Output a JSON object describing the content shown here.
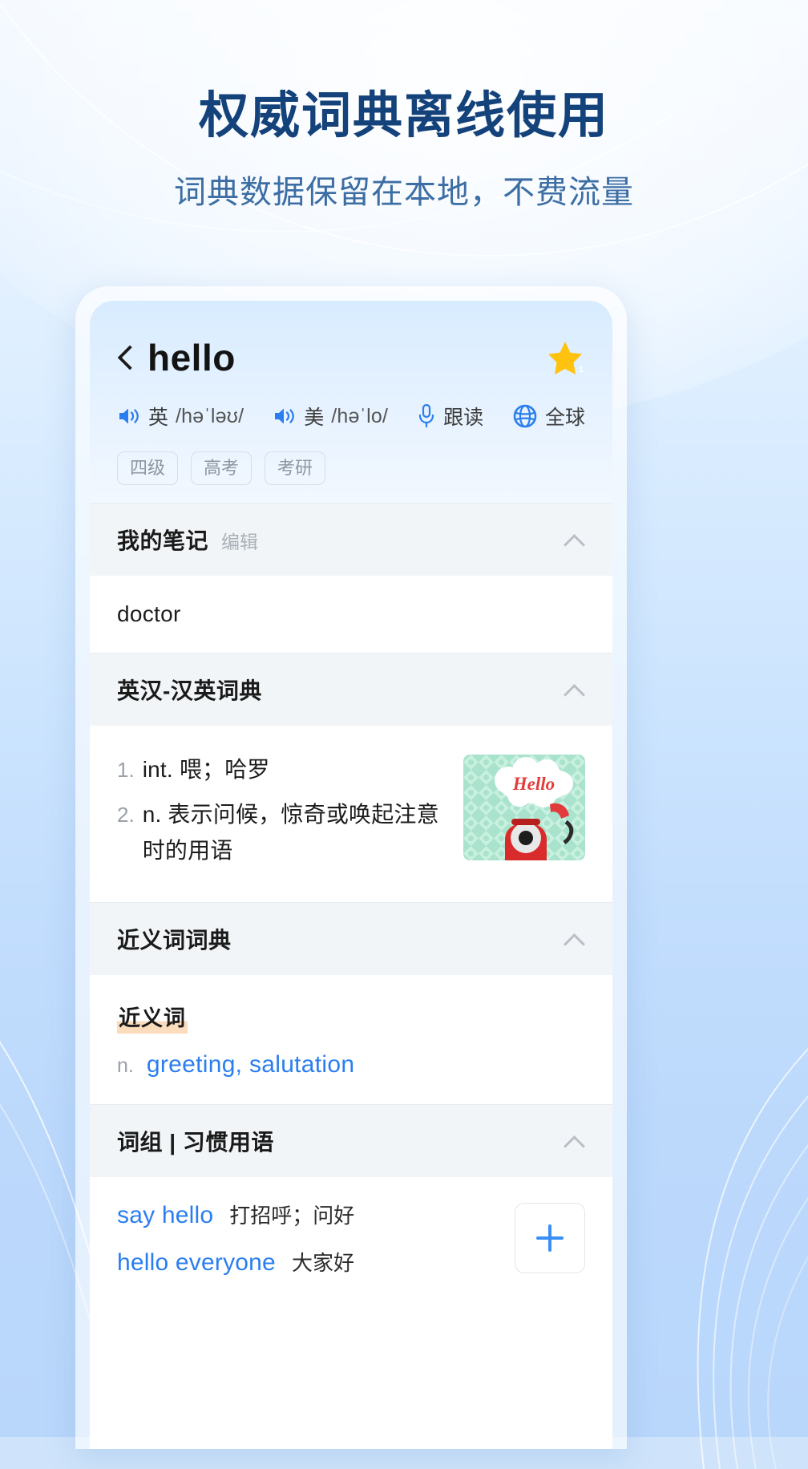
{
  "promo": {
    "headline": "权威词典离线使用",
    "subheadline": "词典数据保留在本地，不费流量"
  },
  "colors": {
    "brand_blue": "#2a7ef0",
    "headline_navy": "#14427a",
    "subheadline_blue": "#3c6ea4",
    "star_gold": "#ffc20e",
    "highlight_peach": "#fbdcbc",
    "section_bg": "#f2f5f7"
  },
  "app": {
    "header": {
      "back_icon": "back-chevron-icon",
      "word": "hello",
      "favorite_icon": "star-icon",
      "favorite_badge": "1",
      "pronunciations": [
        {
          "icon": "speaker-icon",
          "label": "英",
          "ipa": "/həˈləʊ/"
        },
        {
          "icon": "speaker-icon",
          "label": "美",
          "ipa": "/həˈlo/"
        }
      ],
      "follow_read": {
        "icon": "microphone-icon",
        "label": "跟读"
      },
      "global": {
        "icon": "globe-icon",
        "label": "全球"
      },
      "exam_tags": [
        "四级",
        "高考",
        "考研"
      ]
    },
    "sections": [
      {
        "id": "my-notes",
        "title": "我的笔记",
        "action": "编辑",
        "collapse_icon": "chevron-up-icon",
        "note": "doctor"
      },
      {
        "id": "ec-ce-dictionary",
        "title": "英汉-汉英词典",
        "collapse_icon": "chevron-up-icon",
        "definitions": [
          {
            "num": "1.",
            "text": "int. 喂；哈罗"
          },
          {
            "num": "2.",
            "text": "n. 表示问候，惊奇或唤起注意时的用语"
          }
        ],
        "illustration": {
          "name": "hello-telephone-illustration",
          "caption": "Hello"
        }
      },
      {
        "id": "synonym-dictionary",
        "title": "近义词词典",
        "collapse_icon": "chevron-up-icon",
        "group_label": "近义词",
        "pos": "n.",
        "words": "greeting, salutation"
      },
      {
        "id": "phrases",
        "title": "词组 | 习惯用语",
        "collapse_icon": "chevron-up-icon",
        "add_icon": "plus-icon",
        "items": [
          {
            "en": "say hello",
            "cn": "打招呼；问好"
          },
          {
            "en": "hello everyone",
            "cn": "大家好"
          }
        ]
      }
    ]
  }
}
